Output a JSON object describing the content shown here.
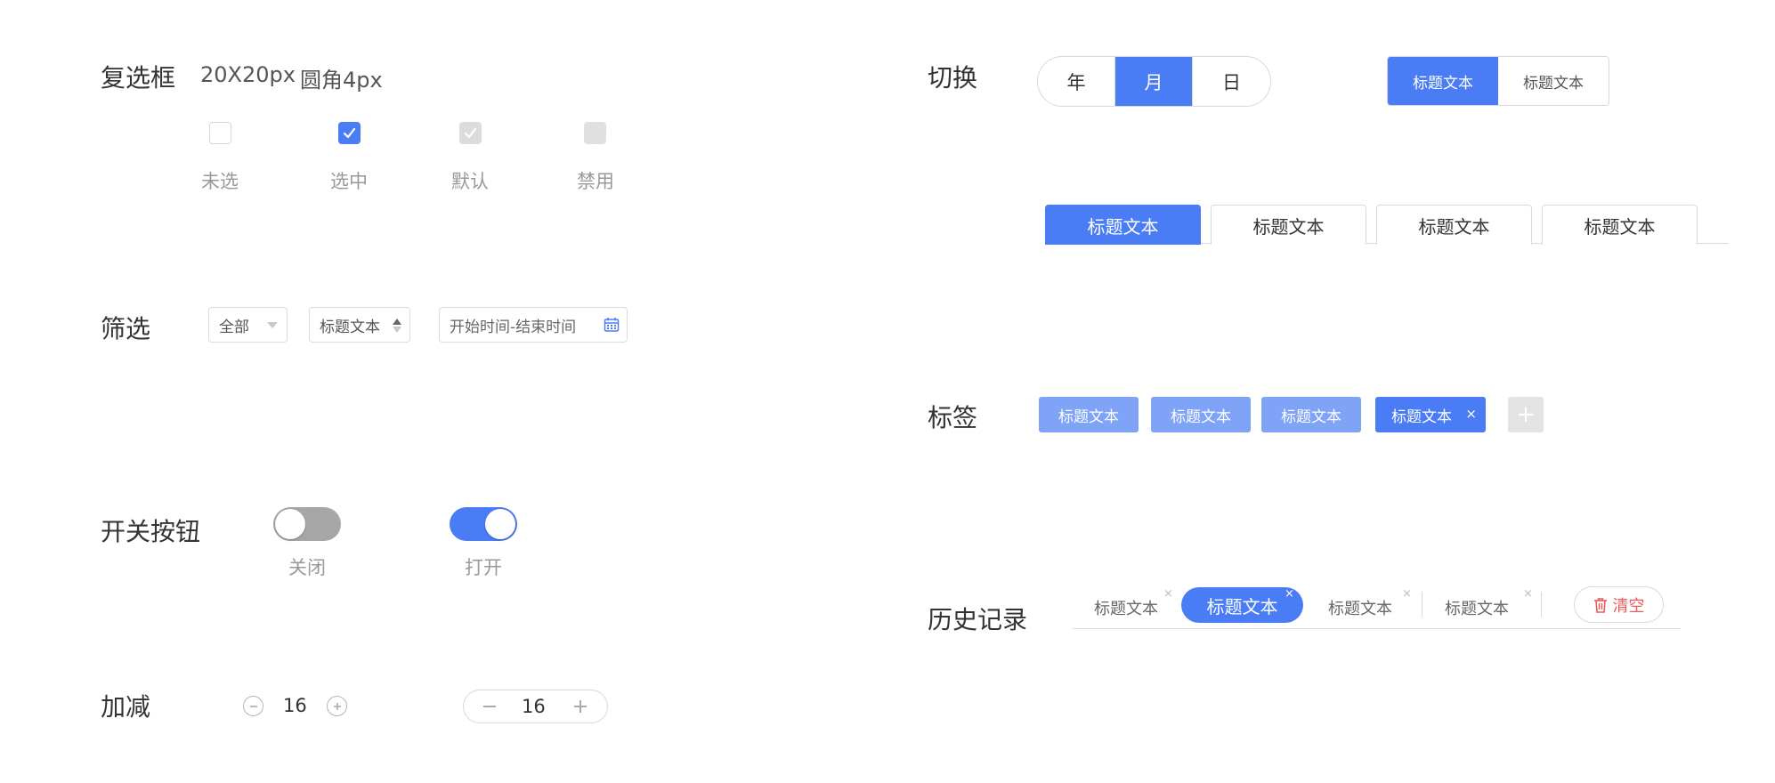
{
  "checkbox": {
    "title": "复选框",
    "spec_size": "20X20px",
    "spec_radius": "圆角4px",
    "states": [
      "未选",
      "选中",
      "默认",
      "禁用"
    ]
  },
  "filter": {
    "title": "筛选",
    "select_all": "全部",
    "select_title": "标题文本",
    "date_range_placeholder": "开始时间-结束时间"
  },
  "switch": {
    "title": "开关按钮",
    "off_label": "关闭",
    "on_label": "打开",
    "off_color": "#a6a6a6",
    "on_color": "#4a7cf6"
  },
  "stepper": {
    "title": "加减",
    "value_a": "16",
    "value_b": "16"
  },
  "toggle": {
    "title": "切换",
    "segments": [
      "年",
      "月",
      "日"
    ],
    "active_segment": "月",
    "pair": [
      "标题文本",
      "标题文本"
    ],
    "tabs": [
      "标题文本",
      "标题文本",
      "标题文本",
      "标题文本"
    ]
  },
  "tags": {
    "title": "标签",
    "items": [
      "标题文本",
      "标题文本",
      "标题文本",
      "标题文本"
    ],
    "close": "×",
    "add": "+"
  },
  "history": {
    "title": "历史记录",
    "items": [
      "标题文本",
      "标题文本",
      "标题文本",
      "标题文本"
    ],
    "close": "×",
    "clear_label": "清空"
  },
  "colors": {
    "accent": "#4a7cf6",
    "accent_light": "#7ea3f7",
    "danger": "#ee5a5a"
  }
}
